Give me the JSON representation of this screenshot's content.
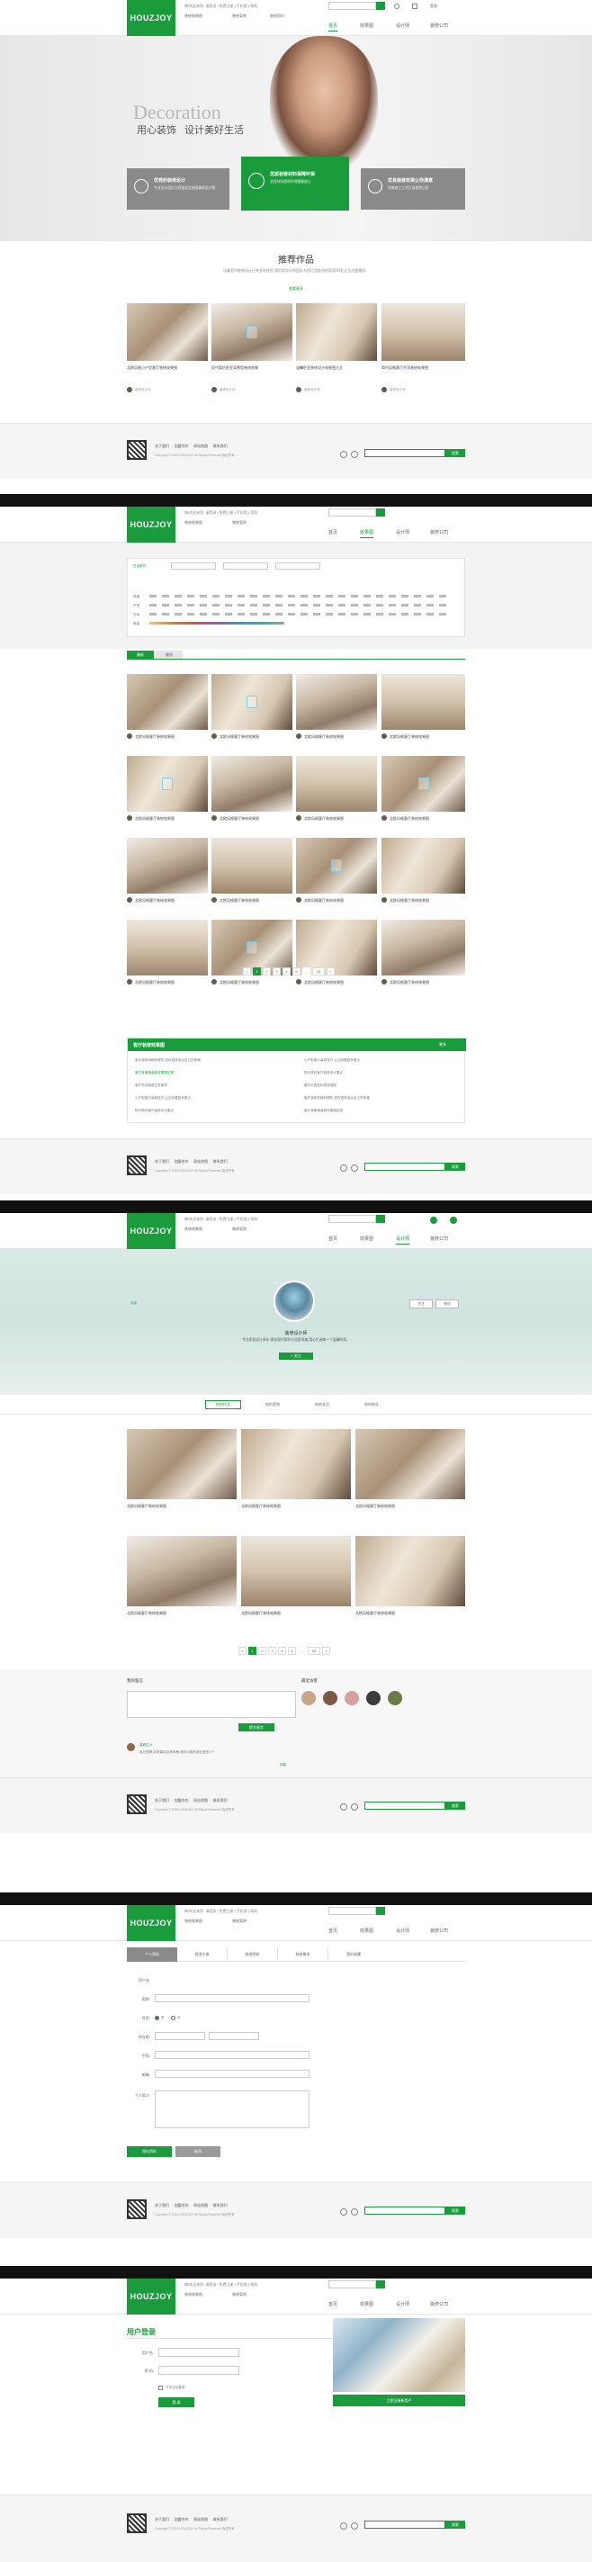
{
  "brand": {
    "logo": "HOUZJOY",
    "accent": "#1a9b3c",
    "dark": "#111111"
  },
  "header": {
    "topline": "嗨!欢迎来到 ,请登录 ! 免费注册 | 手机版 | 帮助",
    "links": [
      "装修效果图",
      "装修案例",
      "装修知识",
      "问答"
    ],
    "nav": [
      "首页",
      "效果图",
      "设计师",
      "装修公司",
      "团购"
    ],
    "login": "登录"
  },
  "hero": {
    "word": "Decoration",
    "slogan_a": "用心装饰",
    "slogan_b": "设计美好生活",
    "cards": [
      {
        "title": "优秀的装修设计",
        "text": "专业设计团队为您量身定制温馨家居方案"
      },
      {
        "title": "优质装修材料保障环保",
        "text": "全程材料透明环保健康放心"
      },
      {
        "title": "优良装修效果让你满意",
        "text": "完美施工工艺打造理想之家"
      }
    ]
  },
  "recommend": {
    "title": "推荐作品",
    "desc": "从事室内装修设计已有多年经验,我们的设计师团队为您打造舒适的家居环境,让生活更美好。",
    "more": "查看更多",
    "items": [
      {
        "title": "北欧风格小户型客厅装修效果图",
        "author": "装修设计师"
      },
      {
        "title": "现代简约卧室背景墙装修效果",
        "author": "装修设计师"
      },
      {
        "title": "温馨卧室装修设计效果图大全",
        "author": "装修设计师"
      },
      {
        "title": "简约风格客厅吊顶装修效果图",
        "author": "装修设计师"
      }
    ]
  },
  "footer": {
    "links": [
      "关于我们",
      "加盟合作",
      "网站地图",
      "联系我们",
      "意见反馈",
      "友情链接"
    ],
    "copyright": "Copyright © 2015 HOUZJOY All Rights Reserved 版权所有",
    "search_btn": "搜索"
  },
  "gallery": {
    "filter_label": "已选条件:",
    "filters": [
      "风格",
      "户型",
      "空间",
      "局部",
      "颜色"
    ],
    "tabs": [
      "最新",
      "最热"
    ],
    "card_title": "北欧风格客厅装修效果图",
    "pages": [
      "1",
      "2",
      "3",
      "4",
      "5",
      "...",
      "20",
      ">"
    ]
  },
  "articles": {
    "title": "客厅装修效果图",
    "more": "更多",
    "items": [
      "客厅装修风格有哪些 如何选择适合自己的风格",
      "小户型客厅装修技巧 让空间看起来更大",
      "客厅背景墙装修效果图欣赏",
      "现代简约客厅装修设计要点",
      "客厅吊顶装修注意事项",
      "客厅灯具如何选择搭配"
    ]
  },
  "designer": {
    "name": "装修设计师",
    "city": "北京",
    "intro": "专注家居设计多年,擅长现代简约与北欧风格,用心打造每一个温馨的家。",
    "btn": "+ 关注",
    "tabs": [
      "他的作品",
      "他的案例",
      "他的关注",
      "他的粉丝"
    ],
    "stats": [
      "关注",
      "粉丝"
    ],
    "comment_title": "我的留言",
    "comment_btn": "提交留言",
    "visitors_title": "最近访客",
    "comments": [
      {
        "user": "装修达人",
        "text": "设计很棒,非常喜欢这种风格,请问大概的造价是多少?"
      },
      {
        "user": "业主小王",
        "text": "已经联系设计师,期待我家的装修效果。"
      }
    ],
    "reply": "回复"
  },
  "profile": {
    "tabs": [
      "个人资料",
      "修改头像",
      "修改密码",
      "装修需求",
      "我的收藏"
    ],
    "rows": [
      "用户名:",
      "昵称:",
      "性别:",
      "所在地:",
      "手机:",
      "邮箱:",
      "个人简介:"
    ],
    "gender": [
      "男",
      "女"
    ],
    "save": "保存资料",
    "cancel": "取消"
  },
  "register": {
    "title": "用户登录",
    "fields": [
      "用户名:",
      "密 码:"
    ],
    "remember": "下次自动登录",
    "btn": "登 录",
    "reg_btn": "立即注册新用户"
  }
}
